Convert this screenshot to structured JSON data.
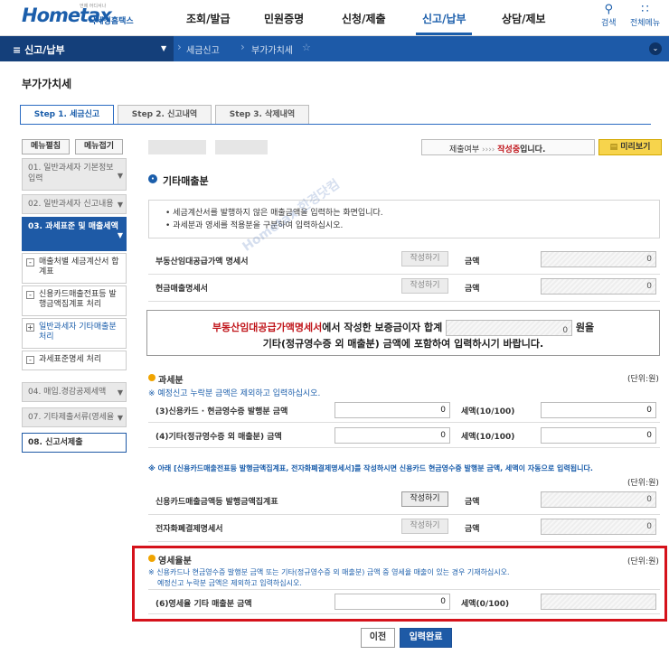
{
  "header": {
    "logo": "Hometax",
    "logo_sub": "국세청홈택스",
    "logo_tiny": "언제 어디서나",
    "nav": [
      "조회/발급",
      "민원증명",
      "신청/제출",
      "신고/납부",
      "상담/제보"
    ],
    "search": "검색",
    "allmenu": "전체메뉴"
  },
  "bar": {
    "section": "신고/납부",
    "crumb1": "세금신고",
    "crumb2": "부가가치세"
  },
  "page_title": "부가가치세",
  "tabs": [
    "Step 1. 세금신고",
    "Step 2. 신고내역",
    "Step 3. 삭제내역"
  ],
  "side": {
    "btn1": "메뉴펼침",
    "btn2": "메뉴접기",
    "i1": "01. 일반과세자 기본정보 입력",
    "i2": "02. 일반과세자 신고내용",
    "i3": "03. 과세표준 및 매출세액",
    "s1": "매출처별 세금계산서 합계표",
    "s2": "신용카드매출전표등 발행금액집계표 처리",
    "s3": "일반과세자 기타매출분 처리",
    "s4": "과세표준명세 처리",
    "i4": "04. 매입.경감공제세액",
    "i5": "07. 기타제출서류(영세율",
    "i6": "08. 신고서제출"
  },
  "status": {
    "label": "제출여부",
    "arrows": "››››",
    "state": "작성중",
    "suffix": "입니다.",
    "preview": "미리보기"
  },
  "main": {
    "title": "기타매출분",
    "notes": [
      "세금계산서를 발행하지 않은 매출금액을 입력하는 화면입니다.",
      "과세분과 영세를 적용분을 구분하여 입력하십시오."
    ],
    "write": "작성하기",
    "amount": "금액",
    "tax10": "세액(10/100)",
    "tax0": "세액(0/100)",
    "unit": "(단위:원)",
    "r1": "부동산임대공급가액 명세서",
    "r1v": "0",
    "r2": "현금매출명세서",
    "r2v": "0",
    "warn_red": "부동산임대공급가액명세서",
    "warn1": "에서 작성한 보증금이자 합계",
    "warn_v": "0",
    "warn_won": "원을",
    "warn2": "기타(정규영수증 외 매출분) 금액에 포함하여 입력하시기 바랍니다.",
    "tax_title": "과세분",
    "tax_note": "※ 예정신고 누락분 금액은 제외하고 입력하십시오.",
    "t3": "(3)신용카드 · 현금영수증 발행분 금액",
    "t3v": "0",
    "t3t": "0",
    "t4": "(4)기타(정규영수증 외 매출분) 금액",
    "t4v": "0",
    "t4t": "0",
    "info": "※ 아래 [신용카드매출전표등 발행금액집계표, 전자화폐결제명세서]를 작성하시면 신용카드 현금영수증 발행분 금액, 세액이 자동으로 입력됩니다.",
    "c1": "신용카드매출금액등 발행금액집계표",
    "c1v": "0",
    "c2": "전자화폐결제명세서",
    "c2v": "0",
    "zero_title": "영세율분",
    "zero_note1": "※ 신용카드나 현금영수증 발행분 금액 또는 기타(정규영수증 외 매출분) 금액 중 영세율 매출이 있는 경우 기재하십시오.",
    "zero_note2": "예정신고 누락분 금액은 제외하고 입력하십시오.",
    "z6": "(6)영세율 기타 매출분 금액",
    "z6v": "0"
  },
  "buttons": {
    "prev": "이전",
    "done": "입력완료"
  },
  "watermark": "Hometax 한경닷컴"
}
